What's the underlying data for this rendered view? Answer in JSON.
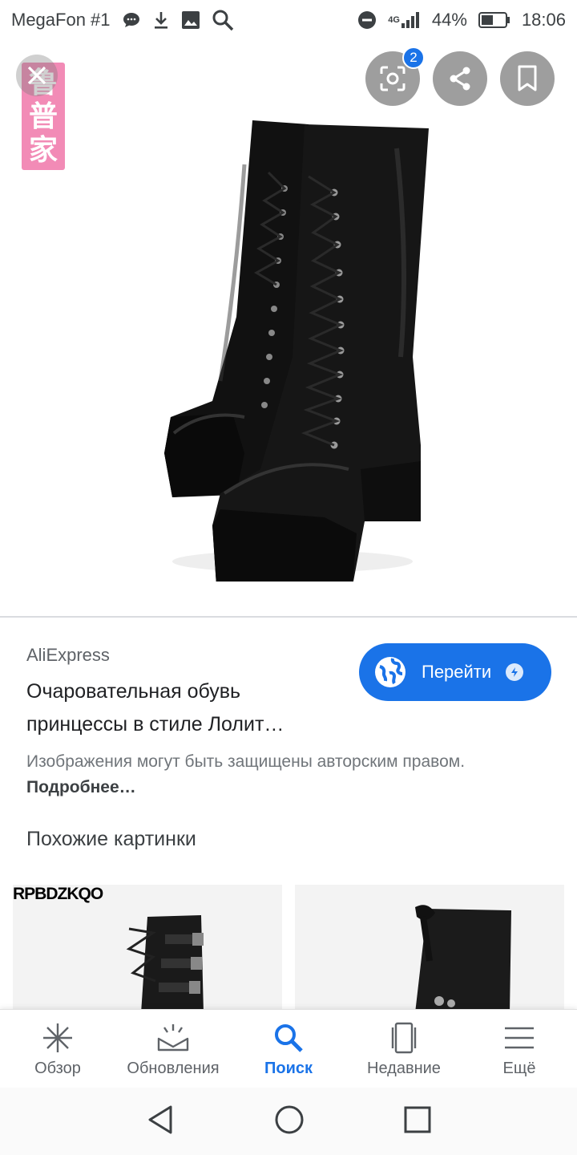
{
  "status_bar": {
    "carrier": "MegaFon #1",
    "network": "4G",
    "battery": "44%",
    "time": "18:06"
  },
  "watermark_text": "鲁普家",
  "lens_badge_count": "2",
  "result": {
    "source": "AliExpress",
    "title": "Очаровательная обувь принцессы в стиле Лолит…",
    "visit_label": "Перейти",
    "copyright_text": "Изображения могут быть защищены авторским правом.",
    "more_link": "Подробнее…"
  },
  "similar": {
    "heading": "Похожие картинки",
    "tile1_brand": "RPBDZKQO"
  },
  "bottom_nav": {
    "items": [
      {
        "label": "Обзор",
        "icon": "discover-icon"
      },
      {
        "label": "Обновления",
        "icon": "updates-icon"
      },
      {
        "label": "Поиск",
        "icon": "search-icon"
      },
      {
        "label": "Недавние",
        "icon": "recent-icon"
      },
      {
        "label": "Ещё",
        "icon": "menu-icon"
      }
    ],
    "active": "Поиск"
  },
  "colors": {
    "accent": "#1a73e8",
    "watermark": "#f28bb6"
  }
}
